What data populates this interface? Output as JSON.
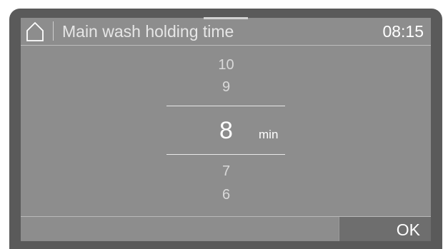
{
  "header": {
    "title": "Main wash holding time",
    "clock": "08:15",
    "home_icon": "home-icon"
  },
  "picker": {
    "values_above": [
      "10",
      "9"
    ],
    "selected_value": "8",
    "unit": "min",
    "values_below": [
      "7",
      "6"
    ]
  },
  "footer": {
    "ok_label": "OK"
  },
  "colors": {
    "screen_background": "#8d8d8d",
    "bezel": "#5a5a5a",
    "ok_button_background": "#6e6e6e",
    "selected_text": "#ffffff",
    "dimmed_text": "#d9d9d9"
  }
}
